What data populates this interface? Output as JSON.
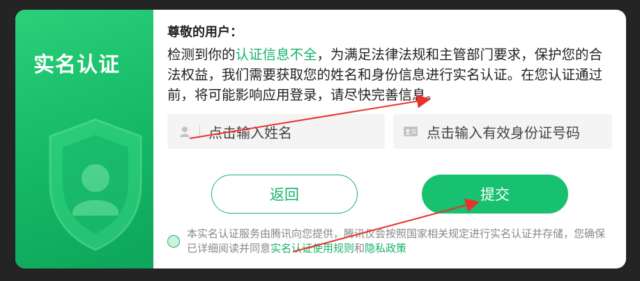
{
  "sidebar": {
    "title": "实名认证"
  },
  "content": {
    "greeting": "尊敬的用户：",
    "desc_part1": "检测到你的",
    "desc_highlight": "认证信息不全",
    "desc_part2": "，为满足法律法规和主管部门要求，保护您的合法权益，我们需要获取您的姓名和身份信息进行实名认证。在您认证通过前，将可能影响应用登录，请尽快完善信息。"
  },
  "form": {
    "name_placeholder": "点击输入姓名",
    "id_placeholder": "点击输入有效身份证号码"
  },
  "buttons": {
    "back": "返回",
    "submit": "提交"
  },
  "agreement": {
    "text_part1": "本实名认证服务由腾讯向您提供，腾讯仅会按照国家相关规定进行实名认证并存储，您确保已详细阅读并同意",
    "link_rules": "实名认证使用规则",
    "and": "和",
    "link_privacy": "隐私政策"
  },
  "colors": {
    "accent": "#17b26a",
    "annotation_arrow": "#e8322c"
  }
}
